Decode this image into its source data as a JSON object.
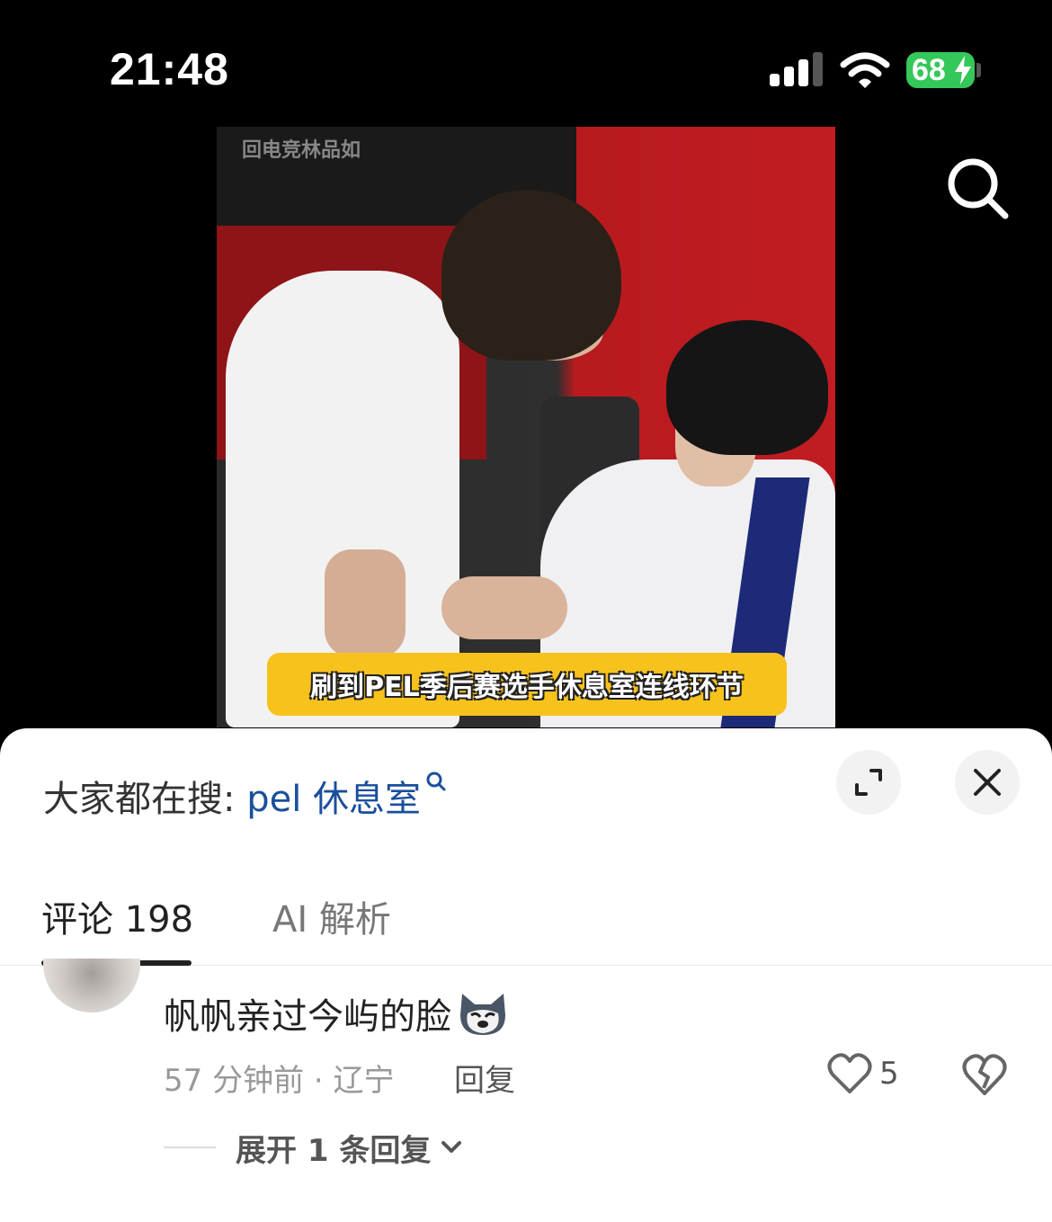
{
  "status_bar": {
    "time": "21:48",
    "battery_level": "68",
    "icons": [
      "signal-icon",
      "wifi-icon",
      "battery-charging-icon"
    ]
  },
  "video": {
    "watermark": "回电竞林品如",
    "caption": "刷到PEL季后赛选手休息室连线环节"
  },
  "sheet": {
    "search_prefix": "大家都在搜: ",
    "search_keyword": "pel 休息室",
    "tabs": {
      "comments": "评论 198",
      "ai": "AI 解析"
    }
  },
  "comment": {
    "text": "帆帆亲过今屿的脸",
    "meta": "57 分钟前 · 辽宁",
    "reply_label": "回复",
    "like_count": "5",
    "expand_label": "展开 1 条回复"
  },
  "colors": {
    "keyword": "#1a4f9c",
    "battery": "#34c759",
    "caption_bg": "#f8c21c"
  }
}
